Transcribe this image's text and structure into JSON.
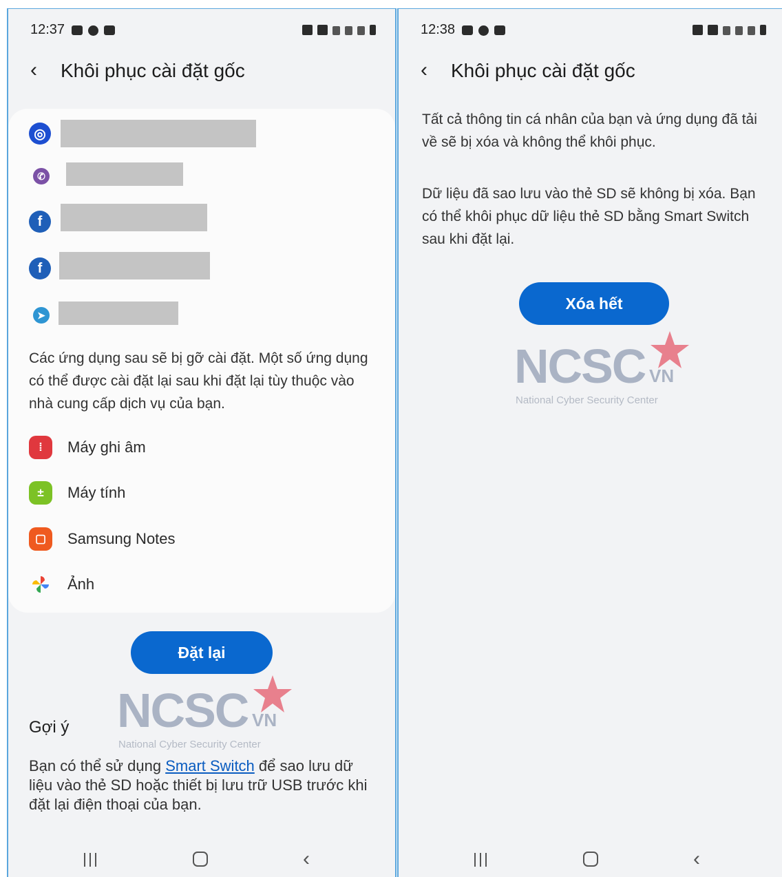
{
  "left": {
    "status": {
      "time": "12:37"
    },
    "title": "Khôi phục cài đặt gốc",
    "accounts": [
      {
        "icon": "samsung-account-icon",
        "color": "#1d4fd1",
        "glyph": "◎"
      },
      {
        "icon": "viber-icon",
        "color": "#7b51a6",
        "glyph": "✆"
      },
      {
        "icon": "facebook-icon",
        "color": "#1f5fb8",
        "glyph": "f"
      },
      {
        "icon": "facebook-icon",
        "color": "#1f5fb8",
        "glyph": "f"
      },
      {
        "icon": "telegram-icon",
        "color": "#2e95d3",
        "glyph": "➤"
      }
    ],
    "uninstall_note": "Các ứng dụng sau sẽ bị gỡ cài đặt. Một số ứng dụng có thể được cài đặt lại sau khi đặt lại tùy thuộc vào nhà cung cấp dịch vụ của bạn.",
    "apps": [
      {
        "label": "Máy ghi âm",
        "icon": "voice-recorder-icon",
        "color": "#e0383e",
        "glyph": "⁞"
      },
      {
        "label": "Máy tính",
        "icon": "calculator-icon",
        "color": "#7cc225",
        "glyph": "±"
      },
      {
        "label": "Samsung Notes",
        "icon": "samsung-notes-icon",
        "color": "#ef5a1f",
        "glyph": "▢"
      },
      {
        "label": "Ảnh",
        "icon": "photos-icon",
        "color": "#ffffff",
        "glyph": "✱"
      }
    ],
    "reset_button": "Đặt lại",
    "tip_title": "Gợi ý",
    "tip_text_before": "Bạn có thể sử dụng ",
    "tip_link": "Smart Switch",
    "tip_text_after": " để sao lưu dữ liệu vào thẻ SD hoặc thiết bị lưu trữ USB trước khi đặt lại điện thoại của bạn."
  },
  "right": {
    "status": {
      "time": "12:38"
    },
    "title": "Khôi phục cài đặt gốc",
    "desc1": "Tất cả thông tin cá nhân của bạn và ứng dụng đã tải về sẽ bị xóa và không thể khôi phục.",
    "desc2": "Dữ liệu đã sao lưu vào thẻ SD sẽ không bị xóa. Bạn có thể khôi phục dữ liệu thẻ SD bằng Smart Switch sau khi đặt lại.",
    "erase_button": "Xóa hết"
  },
  "watermark": {
    "logo": "NCSC",
    "suffix": "VN",
    "subtitle": "National Cyber Security Center"
  },
  "colors": {
    "accent": "#0a68cf",
    "background": "#f2f3f5",
    "card": "#fbfbfb",
    "watermark_star": "#e66b7a"
  }
}
